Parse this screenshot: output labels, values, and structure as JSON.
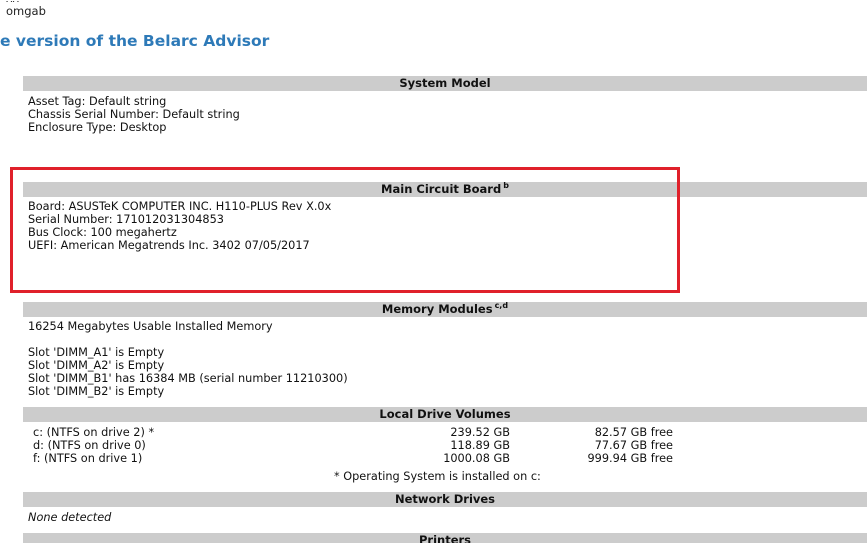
{
  "header": {
    "top_fragment": "yy",
    "username": "omgab",
    "page_title": "e version of the Belarc Advisor"
  },
  "sections": {
    "system_model": {
      "title": "System Model",
      "lines": [
        "Asset Tag: Default string",
        "Chassis Serial Number: Default string",
        "Enclosure Type: Desktop"
      ]
    },
    "main_circuit_board": {
      "title": "Main Circuit Board",
      "sup": "b",
      "lines": [
        "Board: ASUSTeK COMPUTER INC. H110-PLUS Rev X.0x",
        "Serial Number: 171012031304853",
        "Bus Clock: 100 megahertz",
        "UEFI: American Megatrends Inc. 3402 07/05/2017"
      ]
    },
    "memory_modules": {
      "title": "Memory Modules",
      "sup": "c,d",
      "lines": [
        "16254 Megabytes Usable Installed Memory",
        "Slot 'DIMM_A1' is Empty",
        "Slot 'DIMM_A2' is Empty",
        "Slot 'DIMM_B1' has 16384 MB (serial number 11210300)",
        "Slot 'DIMM_B2' is Empty"
      ]
    },
    "local_drive_volumes": {
      "title": "Local Drive Volumes",
      "rows": [
        {
          "name": "c: (NTFS on drive 2) *",
          "size": "239.52 GB",
          "free": "82.57 GB free"
        },
        {
          "name": "d: (NTFS on drive 0)",
          "size": "118.89 GB",
          "free": "77.67 GB free"
        },
        {
          "name": "f: (NTFS on drive 1)",
          "size": "1000.08 GB",
          "free": "999.94 GB free"
        }
      ],
      "footnote": "* Operating System is installed on c:"
    },
    "network_drives": {
      "title": "Network Drives",
      "lines": [
        "None detected"
      ]
    },
    "printers": {
      "title": "Printers"
    }
  },
  "colors": {
    "heading": "#2e7ab8",
    "section_bg": "#cccccc",
    "highlight": "#e0202a"
  }
}
